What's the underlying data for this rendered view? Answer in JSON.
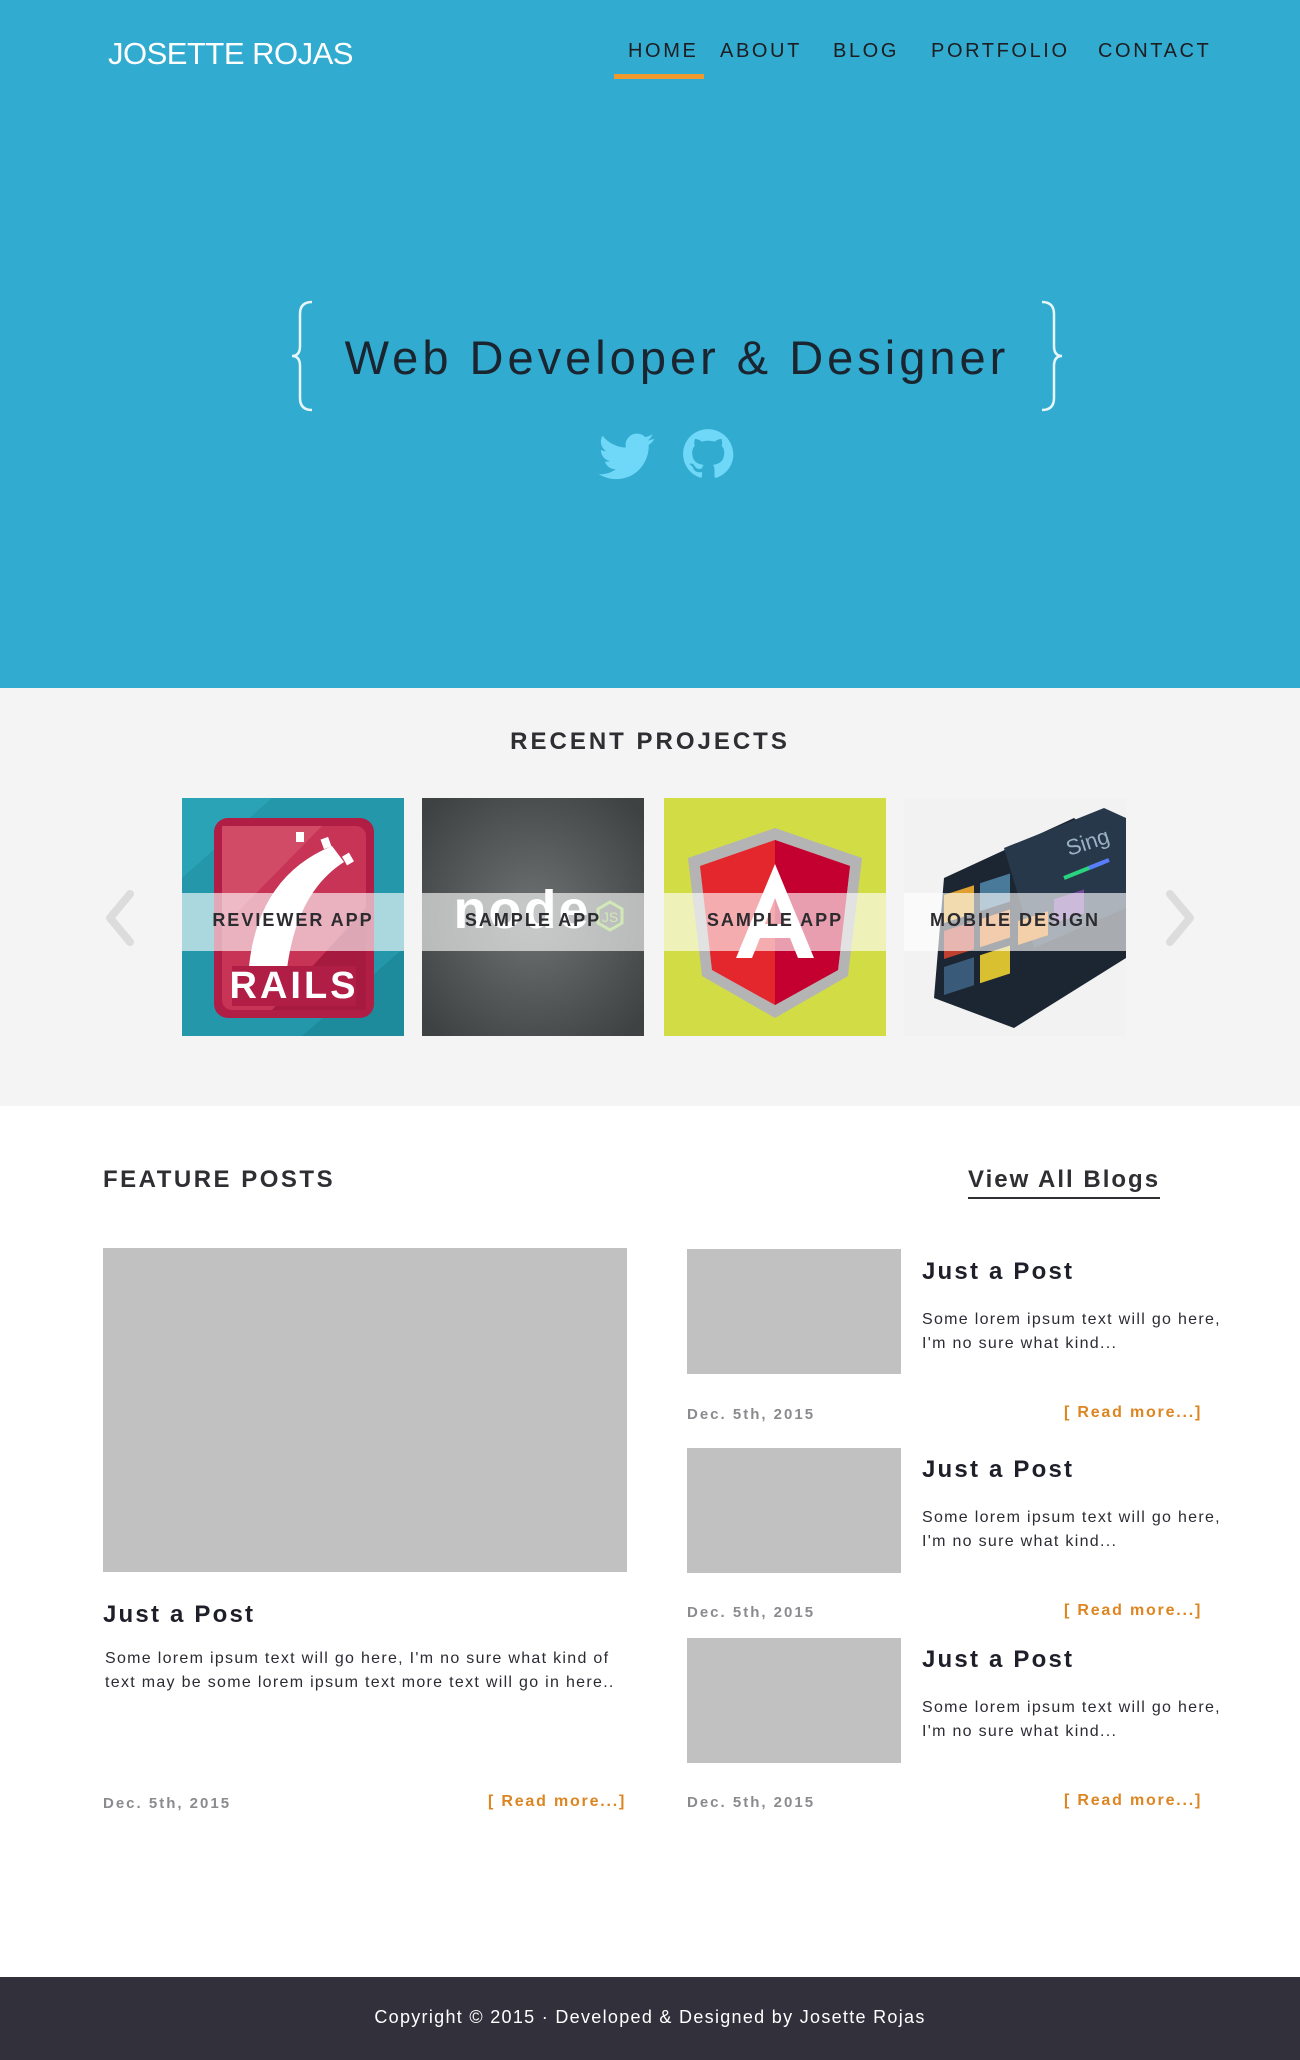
{
  "brand": {
    "name": "JOSETTE ROJAS"
  },
  "nav": {
    "active": "HOME",
    "items": [
      "HOME",
      "ABOUT",
      "BLOG",
      "PORTFOLIO",
      "CONTACT"
    ]
  },
  "hero": {
    "headline": "Web Developer & Designer",
    "social_icons": [
      "twitter-icon",
      "github-icon"
    ]
  },
  "projects": {
    "title": "RECENT PROJECTS",
    "items": [
      {
        "label": "REVIEWER APP",
        "image": "rails-logo"
      },
      {
        "label": "SAMPLE APP",
        "image": "nodejs-logo"
      },
      {
        "label": "SAMPLE APP",
        "image": "angular-logo"
      },
      {
        "label": "MOBILE DESIGN",
        "image": "mobile-app-mockup"
      }
    ],
    "thumbnail_text": {
      "rails": "RAILS",
      "node": "node",
      "app": "Sing"
    }
  },
  "feature_posts": {
    "title": "FEATURE POSTS",
    "view_all": "View All Blogs",
    "main": {
      "title": "Just a Post",
      "excerpt": "Some lorem ipsum text will go here, I'm no sure what kind of text may be some lorem ipsum text more text will go in here..",
      "date": "Dec. 5th, 2015",
      "read_more": "[ Read more...]"
    },
    "side": [
      {
        "title": "Just a Post",
        "excerpt": "Some lorem ipsum text will go here, I'm no sure what kind...",
        "date": "Dec. 5th, 2015",
        "read_more": "[ Read more...]"
      },
      {
        "title": "Just a Post",
        "excerpt": "Some lorem ipsum text will go here, I'm no sure what kind...",
        "date": "Dec. 5th, 2015",
        "read_more": "[ Read more...]"
      },
      {
        "title": "Just a Post",
        "excerpt": "Some lorem ipsum text will go here, I'm no sure what kind...",
        "date": "Dec. 5th, 2015",
        "read_more": "[ Read more...]"
      }
    ]
  },
  "footer": {
    "text": "Copyright © 2015 · Developed & Designed by Josette Rojas"
  },
  "colors": {
    "hero_bg": "#31abcf",
    "accent_underline": "#f09a2e",
    "read_more": "#dd8521",
    "placeholder": "#c1c1c1",
    "footer_bg": "#31303b",
    "projects_bg": "#f4f4f4"
  }
}
